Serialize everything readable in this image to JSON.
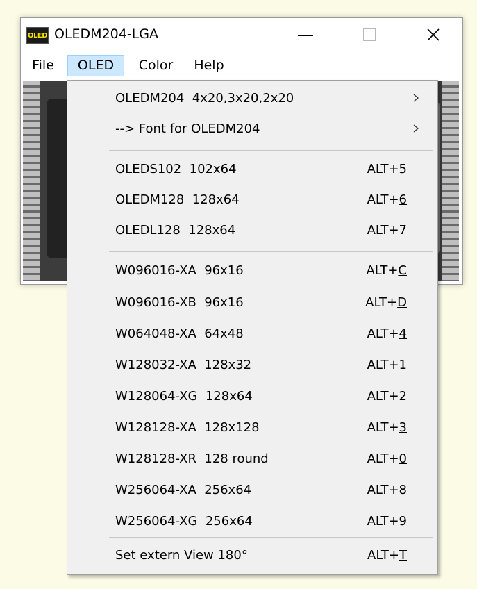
{
  "window": {
    "title": "OLEDM204-LGA",
    "icon_label": "OLED",
    "controls": {
      "minimize_icon": "minimize-icon",
      "maximize_icon": "maximize-icon",
      "close_icon": "close-icon",
      "close_glyph": "✕"
    }
  },
  "menubar": {
    "items": [
      {
        "label": "File"
      },
      {
        "label": "OLED",
        "active": true
      },
      {
        "label": "Color"
      },
      {
        "label": "Help"
      }
    ]
  },
  "oled_menu": {
    "items": [
      {
        "label": "OLEDM204  4x20,3x20,2x20",
        "submenu": true
      },
      {
        "label": "--> Font for OLEDM204",
        "submenu": true
      },
      {
        "label": "OLEDS102  102x64",
        "shortcut_prefix": "ALT+",
        "shortcut_key": "5"
      },
      {
        "label": "OLEDM128  128x64",
        "shortcut_prefix": "ALT+",
        "shortcut_key": "6"
      },
      {
        "label": "OLEDL128  128x64",
        "shortcut_prefix": "ALT+",
        "shortcut_key": "7"
      },
      {
        "label": "W096016-XA  96x16",
        "shortcut_prefix": "ALT+",
        "shortcut_key": "C"
      },
      {
        "label": "W096016-XB  96x16",
        "shortcut_prefix": "ALT+",
        "shortcut_key": "D"
      },
      {
        "label": "W064048-XA  64x48",
        "shortcut_prefix": "ALT+",
        "shortcut_key": "4"
      },
      {
        "label": "W128032-XA  128x32",
        "shortcut_prefix": "ALT+",
        "shortcut_key": "1"
      },
      {
        "label": "W128064-XG  128x64",
        "shortcut_prefix": "ALT+",
        "shortcut_key": "2"
      },
      {
        "label": "W128128-XA  128x128",
        "shortcut_prefix": "ALT+",
        "shortcut_key": "3"
      },
      {
        "label": "W128128-XR  128 round",
        "shortcut_prefix": "ALT+",
        "shortcut_key": "0"
      },
      {
        "label": "W256064-XA  256x64",
        "shortcut_prefix": "ALT+",
        "shortcut_key": "8"
      },
      {
        "label": "W256064-XG  256x64",
        "shortcut_prefix": "ALT+",
        "shortcut_key": "9"
      },
      {
        "label": "Set extern View 180°",
        "shortcut_prefix": "ALT+",
        "shortcut_key": "T"
      }
    ]
  },
  "colors": {
    "page_background": "#fbfbe6",
    "menu_highlight": "#cce8ff",
    "menu_highlight_border": "#99d1ff",
    "dropdown_background": "#f0f0f0",
    "icon_text": "#f2e100"
  }
}
